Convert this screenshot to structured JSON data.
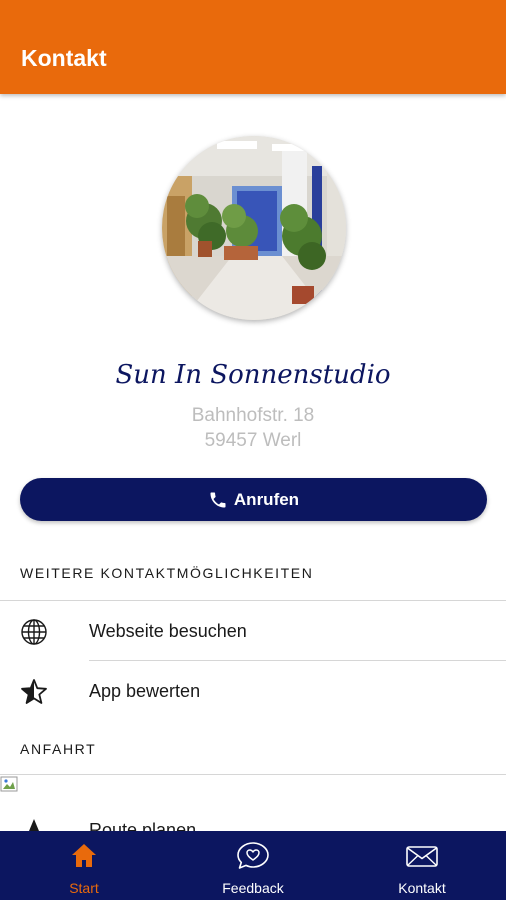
{
  "app_bar": {
    "title": "Kontakt"
  },
  "business": {
    "name": "Sun In Sonnenstudio",
    "street": "Bahnhofstr. 18",
    "city": "59457 Werl"
  },
  "call_button": {
    "label": "Anrufen",
    "icon": "phone-icon"
  },
  "sections": {
    "more_contact": "WEITERE KONTAKTMÖGLICHKEITEN",
    "directions": "ANFAHRT"
  },
  "contact_items": [
    {
      "label": "Webseite besuchen",
      "icon": "globe-icon"
    },
    {
      "label": "App bewerten",
      "icon": "star-half-icon"
    }
  ],
  "route_item": {
    "label": "Route planen",
    "icon": "navigation-arrow-icon"
  },
  "bottom_nav": [
    {
      "label": "Start",
      "icon": "home-icon",
      "active": true
    },
    {
      "label": "Feedback",
      "icon": "heart-chat-icon",
      "active": false
    },
    {
      "label": "Kontakt",
      "icon": "mail-icon",
      "active": false
    }
  ],
  "colors": {
    "accent": "#e96a0c",
    "navy": "#0c1660",
    "address_gray": "#bdbdbd"
  }
}
